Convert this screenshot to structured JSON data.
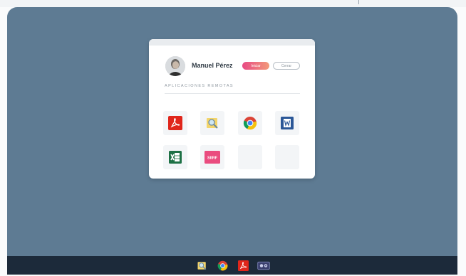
{
  "user": {
    "name": "Manuel Pérez",
    "ok_label": "Iniciar",
    "cancel_label": "Cerrar"
  },
  "section": {
    "title": "APLICACIONES REMOTAS"
  },
  "apps": [
    {
      "icon": "pdf-reader-icon"
    },
    {
      "icon": "file-search-icon"
    },
    {
      "icon": "chrome-icon"
    },
    {
      "icon": "word-icon"
    },
    {
      "icon": "excel-icon"
    },
    {
      "icon": "siirf-icon",
      "label": "SIIRF"
    },
    {
      "icon": "empty-slot"
    },
    {
      "icon": "empty-slot"
    }
  ],
  "taskbar": {
    "icons": [
      "file-search-icon",
      "chrome-icon",
      "pdf-reader-icon",
      "media-icon"
    ]
  },
  "colors": {
    "desktop": "#5e7b93",
    "taskbar": "#1c2a3a",
    "accent_start": "#e84a84",
    "accent_end": "#f29a7a"
  }
}
